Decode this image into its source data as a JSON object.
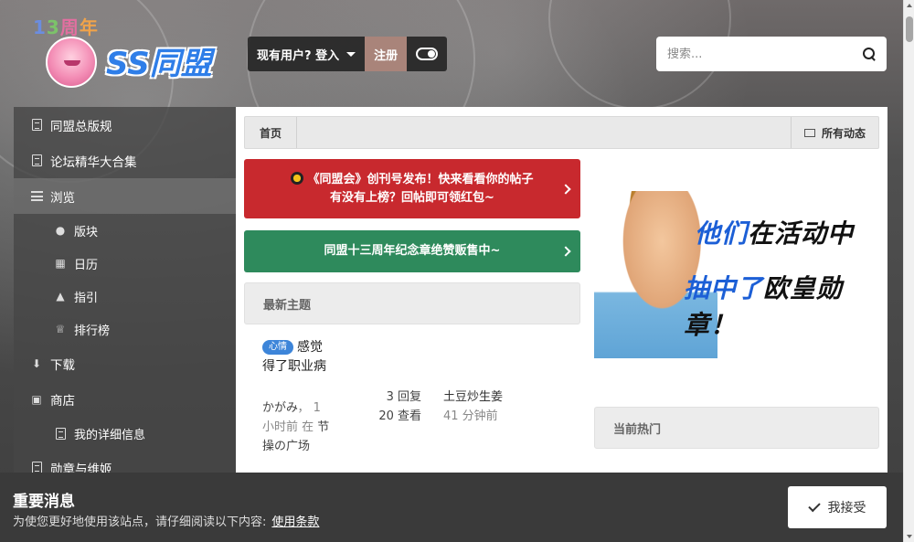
{
  "header": {
    "logo": {
      "anniversary": "13周年",
      "brand": "SS同盟"
    },
    "user_bar": {
      "login_label": "现有用户? 登入",
      "register_label": "注册"
    },
    "search": {
      "placeholder": "搜索..."
    }
  },
  "sidebar": {
    "items": [
      {
        "label": "同盟总版规",
        "icon": "doc-icon"
      },
      {
        "label": "论坛精华大合集",
        "icon": "doc-icon"
      },
      {
        "label": "浏览",
        "icon": "list-icon",
        "active": true
      },
      {
        "label": "版块",
        "icon": "comments-icon"
      },
      {
        "label": "日历",
        "icon": "calendar-icon"
      },
      {
        "label": "指引",
        "icon": "warning-icon"
      },
      {
        "label": "排行榜",
        "icon": "trophy-icon"
      },
      {
        "label": "下载",
        "icon": "download-icon"
      },
      {
        "label": "商店",
        "icon": "cart-icon"
      },
      {
        "label": "我的详细信息",
        "icon": "doc-icon"
      },
      {
        "label": "勋章与维姬",
        "icon": "doc-icon"
      }
    ]
  },
  "breadcrumb": {
    "home": "首页",
    "activity": "所有动态"
  },
  "banners": {
    "red": {
      "line1": "《同盟会》创刊号发布！快来看看你的帖子",
      "line2": "有没有上榜？回帖即可领红包~"
    },
    "green": {
      "text": "同盟十三周年纪念章绝赞贩售中~"
    }
  },
  "latest": {
    "heading": "最新主题",
    "topic": {
      "badge": "心情",
      "title": "感觉得了职业病",
      "author": "かがみ",
      "time": "1 小时前 在",
      "forum": "节操の广场",
      "replies": "3 回复",
      "views": "20 查看",
      "last_user": "土豆炒生姜",
      "last_time": "41 分钟前"
    }
  },
  "ad": {
    "line1_a": "他们",
    "line1_b": "在活动中",
    "line2_a": "抽中了",
    "line2_b": "欧皇勋章！"
  },
  "hot": {
    "heading": "当前热门"
  },
  "notice": {
    "title": "重要消息",
    "text": "为使您更好地使用该站点，请仔细阅读以下内容:",
    "link": "使用条款",
    "accept_label": "我接受"
  },
  "colors": {
    "red_banner": "#c8292e",
    "green_banner": "#2e8a5c",
    "register_bg": "#a9847a",
    "badge_blue": "#3d85d9",
    "ad_blue": "#1c5fd6"
  }
}
